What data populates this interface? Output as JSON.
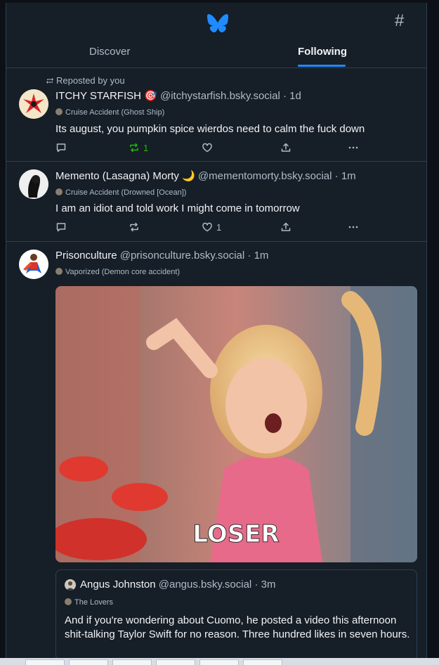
{
  "header": {
    "logo_icon": "butterfly-icon",
    "feeds_icon": "hash-icon",
    "feeds_glyph": "#",
    "tabs": [
      {
        "label": "Discover",
        "active": false
      },
      {
        "label": "Following",
        "active": true
      }
    ],
    "accent": "#208bfe"
  },
  "posts": [
    {
      "repost_label": "Reposted by you",
      "display_name": "ITCHY STARFISH 🎯",
      "handle": "@itchystarfish.bsky.social",
      "time": "· 1d",
      "badge": "Cruise Accident (Ghost Ship)",
      "text": "Its august, you pumpkin spice wierdos need to calm the fuck down",
      "reply_count": "",
      "repost_count": "1",
      "like_count": ""
    },
    {
      "display_name": "Memento (Lasagna) Morty 🌙",
      "handle": "@mementomorty.bsky.social",
      "time": "· 1m",
      "badge": "Cruise Accident (Drowned [Ocean])",
      "text": "I am an idiot and told work I might come in tomorrow",
      "reply_count": "",
      "repost_count": "",
      "like_count": "1"
    },
    {
      "display_name": "Prisonculture",
      "handle": "@prisonculture.bsky.social",
      "time": "· 1m",
      "badge": "Vaporized (Demon core accident)",
      "media_caption": "LOSER",
      "quote": {
        "display_name": "Angus Johnston",
        "handle": "@angus.bsky.social",
        "time": "· 3m",
        "badge": "The Lovers",
        "text": "And if you're wondering about Cuomo, he posted a video this afternoon shit-talking Taylor Swift for no reason. Three hundred likes in seven hours."
      }
    }
  ],
  "colors": {
    "background": "#161e27",
    "border": "#2e4052",
    "repost_active": "#20bc07",
    "muted_text": "#aebbc9"
  }
}
